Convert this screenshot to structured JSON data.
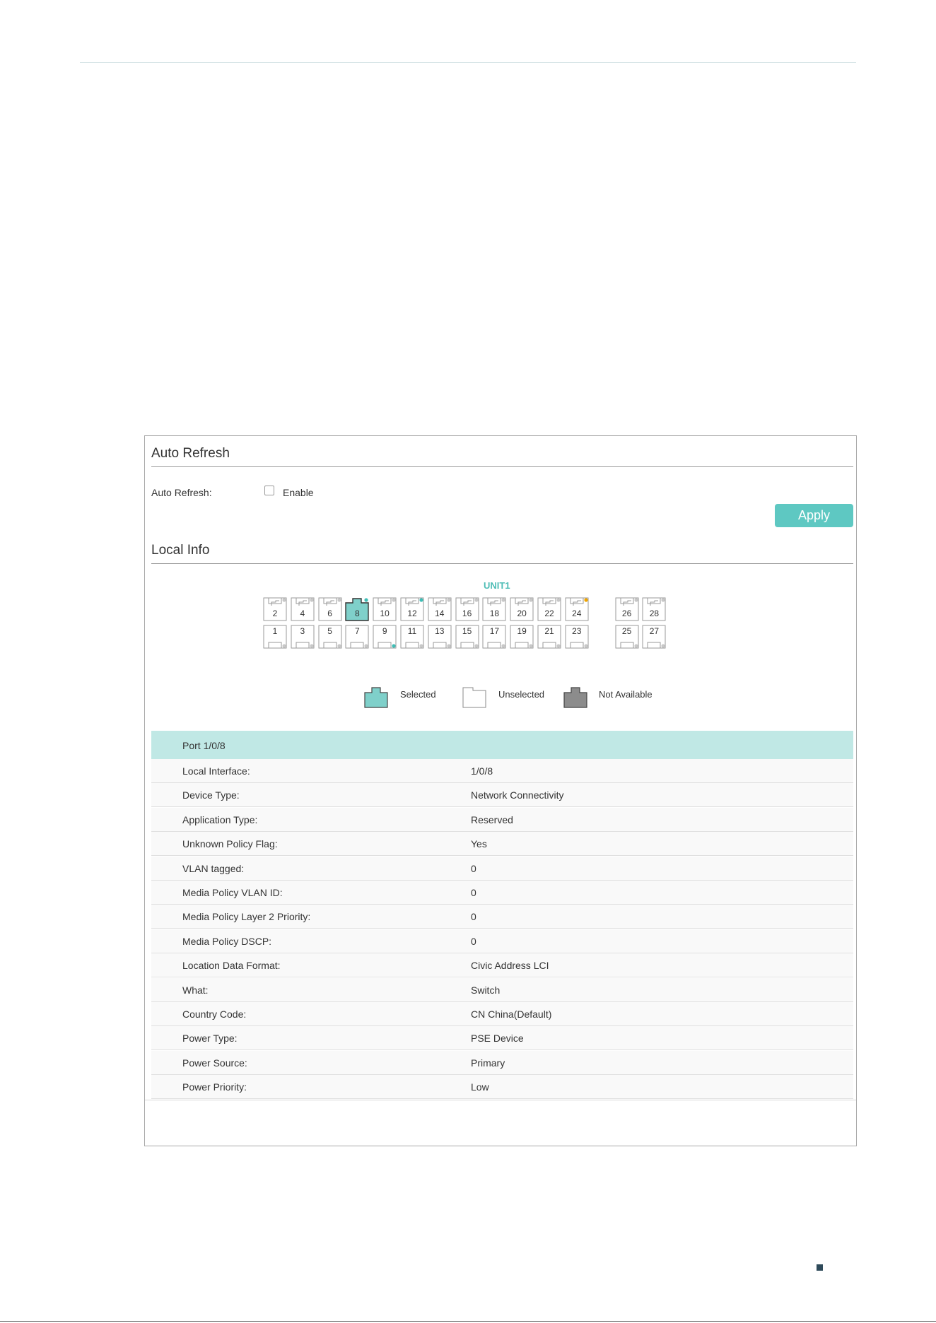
{
  "auto_refresh": {
    "section_title": "Auto Refresh",
    "label": "Auto Refresh:",
    "checkbox_label": "Enable",
    "checked": false,
    "apply_label": "Apply"
  },
  "local_info": {
    "section_title": "Local Info",
    "unit_label": "UNIT1",
    "selected_port": "8",
    "ports_top": [
      {
        "num": "2",
        "led": "grey"
      },
      {
        "num": "4",
        "led": "grey"
      },
      {
        "num": "6",
        "led": "grey"
      },
      {
        "num": "8",
        "led": "teal"
      },
      {
        "num": "10",
        "led": "grey"
      },
      {
        "num": "12",
        "led": "teal"
      },
      {
        "num": "14",
        "led": "grey"
      },
      {
        "num": "16",
        "led": "grey"
      },
      {
        "num": "18",
        "led": "grey"
      },
      {
        "num": "20",
        "led": "grey"
      },
      {
        "num": "22",
        "led": "grey"
      },
      {
        "num": "24",
        "led": "orange"
      },
      {
        "num": "26",
        "led": "grey"
      },
      {
        "num": "28",
        "led": "grey"
      }
    ],
    "ports_bottom": [
      {
        "num": "1",
        "led": "grey"
      },
      {
        "num": "3",
        "led": "grey"
      },
      {
        "num": "5",
        "led": "grey"
      },
      {
        "num": "7",
        "led": "grey"
      },
      {
        "num": "9",
        "led": "teal"
      },
      {
        "num": "11",
        "led": "grey"
      },
      {
        "num": "13",
        "led": "grey"
      },
      {
        "num": "15",
        "led": "grey"
      },
      {
        "num": "17",
        "led": "grey"
      },
      {
        "num": "19",
        "led": "grey"
      },
      {
        "num": "21",
        "led": "grey"
      },
      {
        "num": "23",
        "led": "grey"
      },
      {
        "num": "25",
        "led": "grey"
      },
      {
        "num": "27",
        "led": "grey"
      }
    ],
    "legend": {
      "selected": "Selected",
      "unselected": "Unselected",
      "not_available": "Not Available"
    },
    "table": {
      "header": "Port 1/0/8",
      "rows": [
        {
          "key": "Local Interface:",
          "value": "1/0/8"
        },
        {
          "key": "Device Type:",
          "value": "Network Connectivity"
        },
        {
          "key": "Application Type:",
          "value": "Reserved"
        },
        {
          "key": "Unknown Policy Flag:",
          "value": "Yes"
        },
        {
          "key": "VLAN tagged:",
          "value": "0"
        },
        {
          "key": "Media Policy VLAN ID:",
          "value": "0"
        },
        {
          "key": "Media Policy Layer 2 Priority:",
          "value": "0"
        },
        {
          "key": "Media Policy DSCP:",
          "value": "0"
        },
        {
          "key": "Location Data Format:",
          "value": "Civic Address LCI"
        },
        {
          "key": "What:",
          "value": "Switch"
        },
        {
          "key": "Country Code:",
          "value": "CN China(Default)"
        },
        {
          "key": "Power Type:",
          "value": "PSE Device"
        },
        {
          "key": "Power Source:",
          "value": "Primary"
        },
        {
          "key": "Power Priority:",
          "value": "Low"
        }
      ]
    }
  },
  "colors": {
    "accent": "#5ec8c2",
    "selected_fill": "#7fd0ca",
    "not_available_fill": "#8c8c8c",
    "led_grey": "#c8c8c8",
    "led_teal": "#3fbdb5",
    "led_orange": "#f0a500",
    "row_highlight": "#c0e8e5"
  }
}
